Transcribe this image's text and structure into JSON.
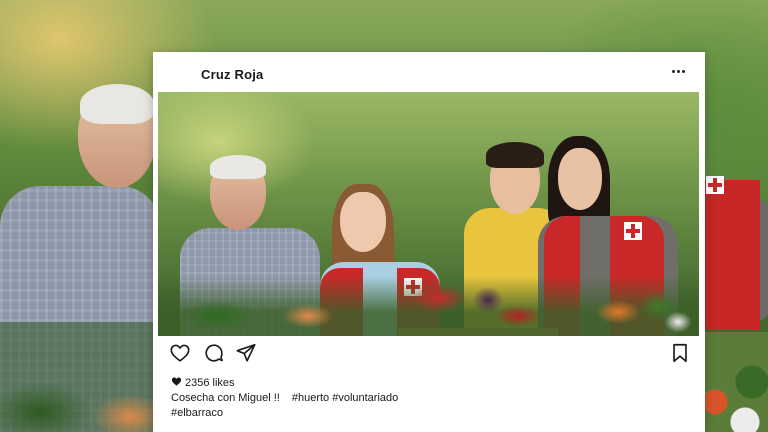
{
  "post": {
    "username": "Cruz Roja",
    "likes": "2356 likes",
    "caption_text": "Cosecha con Miguel !!",
    "caption_hashtags": "#huerto #voluntariado",
    "caption_hashtags_line2": "#elbarraco"
  },
  "icons": {
    "more": "more-options-icon",
    "like": "heart-icon",
    "comment": "comment-icon",
    "share": "send-icon",
    "save": "bookmark-icon",
    "likes_heart": "heart-filled-icon"
  },
  "colors": {
    "card_bg": "#ffffff",
    "text": "#1a1a1a",
    "red_cross_vest": "#c82828"
  }
}
